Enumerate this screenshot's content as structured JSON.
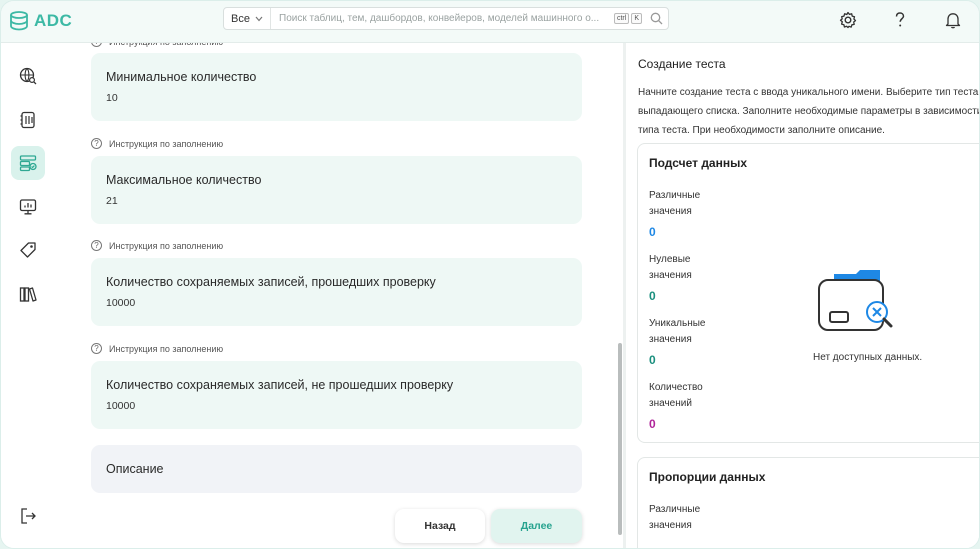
{
  "app": {
    "logo_text": "ADC"
  },
  "search": {
    "scope": "Все",
    "placeholder": "Поиск таблиц, тем, дашбордов, конвейеров, моделей машинного о...",
    "kbd_ctrl": "ctrl",
    "kbd_k": "K"
  },
  "nav": {
    "items": [
      {
        "icon": "globe-search-icon"
      },
      {
        "icon": "notebook-icon"
      },
      {
        "icon": "data-quality-icon",
        "active": true
      },
      {
        "icon": "monitor-chart-icon"
      },
      {
        "icon": "tag-icon"
      },
      {
        "icon": "library-icon"
      }
    ],
    "logout_icon": "logout-icon"
  },
  "form": {
    "hint_text": "Инструкция по заполнению",
    "fields": [
      {
        "label": "Минимальное количество",
        "value": "10"
      },
      {
        "label": "Максимальное количество",
        "value": "21"
      },
      {
        "label": "Количество сохраняемых записей, прошедших проверку",
        "value": "10000"
      },
      {
        "label": "Количество сохраняемых записей, не прошедших проверку",
        "value": "10000"
      }
    ],
    "description_label": "Описание",
    "back_button": "Назад",
    "next_button": "Далее"
  },
  "panel": {
    "title": "Создание теста",
    "description": "Начните создание теста с ввода уникального имени. Выберите тип теста из выпадающего списка. Заполните необходимые параметры в зависимости от типа теста. При необходимости заполните описание.",
    "data_count": {
      "title": "Подсчет данных",
      "stats": [
        {
          "label": "Различные значения",
          "value": "0",
          "color": "#1e88e5"
        },
        {
          "label": "Нулевые значения",
          "value": "0",
          "color": "#1a8f7e"
        },
        {
          "label": "Уникальные значения",
          "value": "0",
          "color": "#1a8f7e"
        },
        {
          "label": "Количество значений",
          "value": "0",
          "color": "#b0259a"
        }
      ],
      "empty_text": "Нет доступных данных."
    },
    "proportions": {
      "title": "Пропорции данных",
      "first_label": "Различные значения"
    }
  },
  "colors": {
    "accent": "#3db9a5",
    "active_nav": "#d9f2ec"
  }
}
